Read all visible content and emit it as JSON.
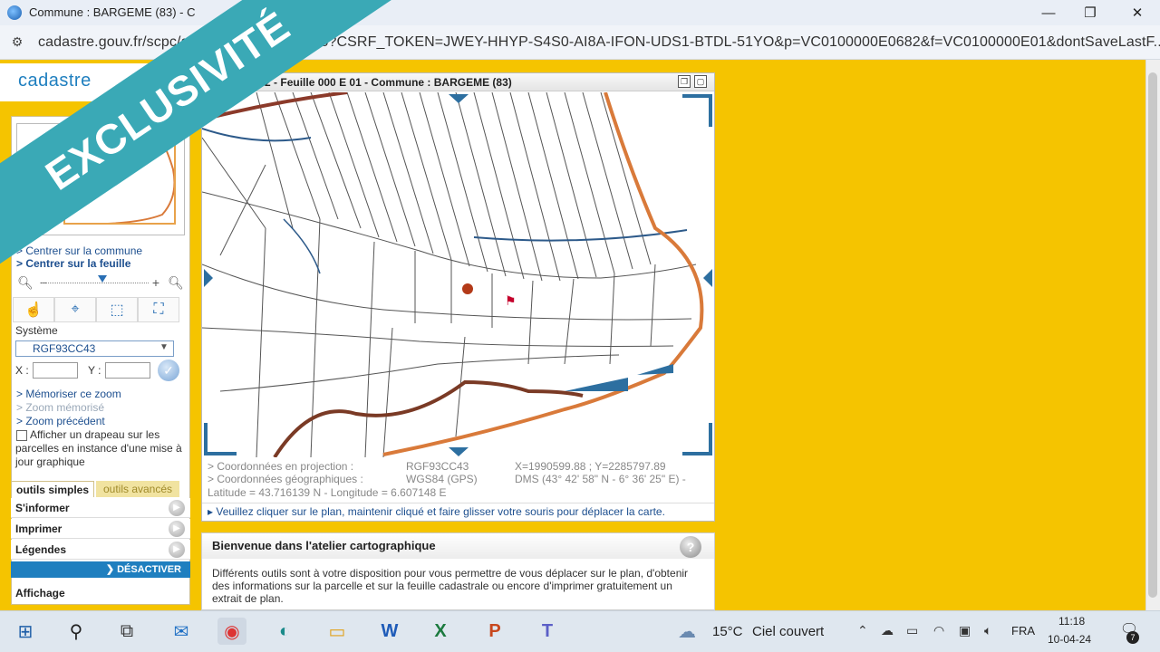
{
  "browser": {
    "tab_title": "Commune : BARGEME (83) - C",
    "url": "cadastre.gouv.fr/scpc/afficherCarteFeuille.do?CSRF_TOKEN=JWEY-HHYP-S4S0-AI8A-IFON-UDS1-BTDL-51YO&p=VC0100000E0682&f=VC0100000E01&dontSaveLastF...",
    "minimize": "—",
    "maximize": "❐",
    "close": "✕"
  },
  "site": {
    "logo": "cadastre"
  },
  "left_panel": {
    "links": {
      "center_commune": "> Centrer sur la commune",
      "center_sheet": "> Centrer sur la feuille"
    },
    "systeme_label": "Système",
    "systeme_value": "RGF93CC43",
    "x_label": "X :",
    "y_label": "Y :",
    "zoom_links": {
      "memorize": "> Mémoriser ce zoom",
      "memorized": "> Zoom mémorisé",
      "previous": "> Zoom précédent"
    },
    "flag_label": "Afficher un drapeau sur les parcelles en instance d'une mise à jour graphique",
    "tabs": {
      "simple": "outils simples",
      "advanced": "outils avancés"
    },
    "menu": [
      "S'informer",
      "Imprimer",
      "Légendes"
    ],
    "deactivate": "DÉSACTIVER",
    "affichage": "Affichage"
  },
  "map": {
    "title": "me 682 - Feuille 000 E 01 - Commune : BARGEME (83)",
    "coords": {
      "projection_label": "> Coordonnées en projection :",
      "projection_system": "RGF93CC43",
      "projection_values": "X=1990599.88 ; Y=2285797.89",
      "geo_label": "> Coordonnées géographiques :",
      "geo_system": "WGS84 (GPS)",
      "geo_dms": "DMS (43° 42' 58\" N - 6° 36' 25\" E) -",
      "geo_latlon": "Latitude = 43.716139 N - Longitude = 6.607148 E"
    },
    "hint": "▸ Veuillez cliquer sur le plan, maintenir cliqué et faire glisser votre souris pour déplacer la carte."
  },
  "welcome": {
    "title": "Bienvenue dans l'atelier cartographique",
    "body": "Différents outils sont à votre disposition pour vous permettre de vous déplacer sur le plan, d'obtenir des informations sur la parcelle et sur la feuille cadastrale ou encore d'imprimer gratuitement un extrait de plan."
  },
  "ribbon": {
    "text": "EXCLUSIVITÉ"
  },
  "taskbar": {
    "weather_temp": "15°C",
    "weather_desc": "Ciel couvert",
    "language": "FRA",
    "time": "11:18",
    "date": "10-04-24",
    "notification_count": "7"
  },
  "colors": {
    "page_background": "#f5c400",
    "ribbon": "#3aa9b6",
    "accent_blue": "#1f7fbf",
    "commune_border": "#d97a3a",
    "river": "#2d5a8a"
  }
}
